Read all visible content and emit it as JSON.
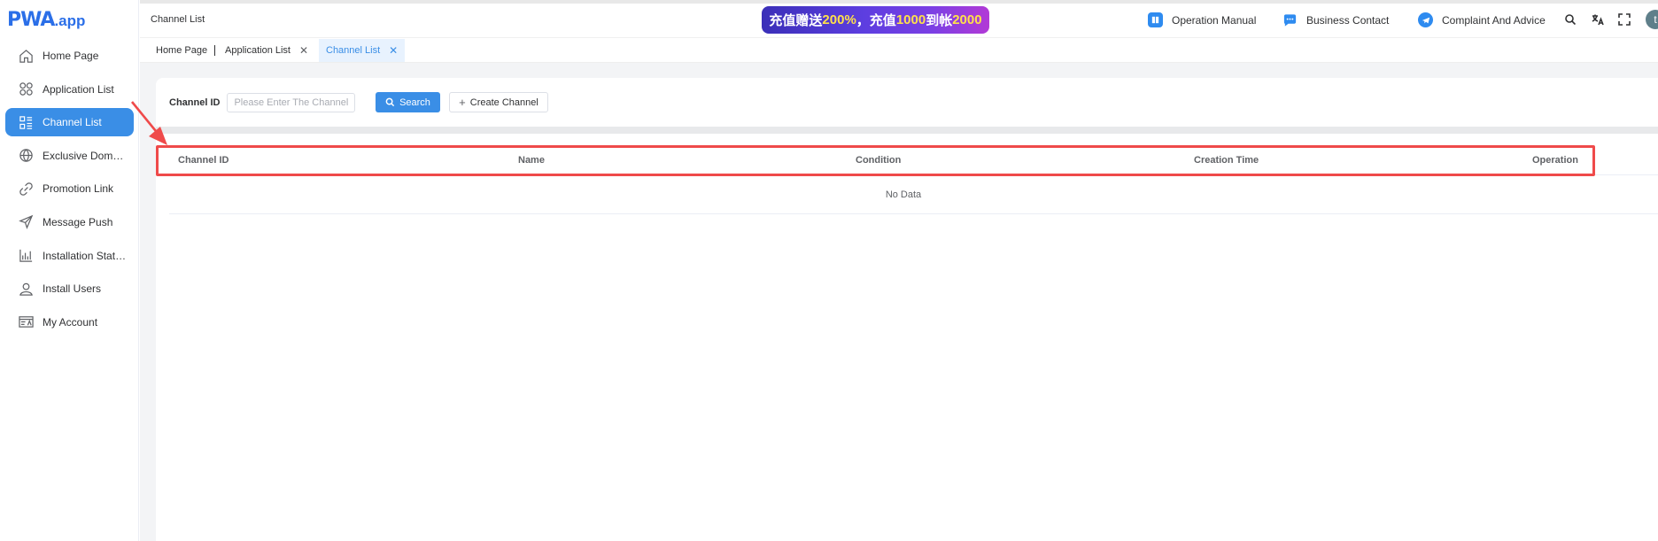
{
  "app": {
    "logo_brand": "PWA",
    "logo_domain": ".app"
  },
  "sidebar": {
    "items": [
      {
        "label": "Home Page",
        "icon": "home-icon"
      },
      {
        "label": "Application List",
        "icon": "apps-grid-icon"
      },
      {
        "label": "Channel List",
        "icon": "channel-list-icon",
        "active": true
      },
      {
        "label": "Exclusive Domain...",
        "icon": "domain-globe-icon"
      },
      {
        "label": "Promotion Link",
        "icon": "link-icon"
      },
      {
        "label": "Message Push",
        "icon": "send-icon"
      },
      {
        "label": "Installation Statist...",
        "icon": "bar-chart-icon"
      },
      {
        "label": "Install Users",
        "icon": "user-icon"
      },
      {
        "label": "My Account",
        "icon": "account-card-icon"
      }
    ]
  },
  "header": {
    "breadcrumb": "Channel List",
    "promo": {
      "part1": "充值赠送",
      "part2": "200%",
      "part3": "，充值",
      "part4": "1000",
      "part5": "到帐",
      "part6": "2000"
    },
    "links": {
      "manual": "Operation Manual",
      "business": "Business Contact",
      "complaint": "Complaint And Advice"
    },
    "avatar_initial": "t"
  },
  "tabs": [
    {
      "label": "Home Page",
      "closable": false
    },
    {
      "label": "Application List",
      "closable": true
    },
    {
      "label": "Channel List",
      "closable": true,
      "active": true
    }
  ],
  "filter": {
    "label": "Channel ID",
    "placeholder": "Please Enter The Channel I",
    "search_label": "Search",
    "create_label": "Create Channel"
  },
  "table": {
    "columns": [
      "Channel ID",
      "Name",
      "Condition",
      "Creation Time",
      "Operation"
    ],
    "empty_text": "No Data"
  },
  "colors": {
    "accent": "#3a8ee6",
    "highlight": "#ef4a4a"
  }
}
